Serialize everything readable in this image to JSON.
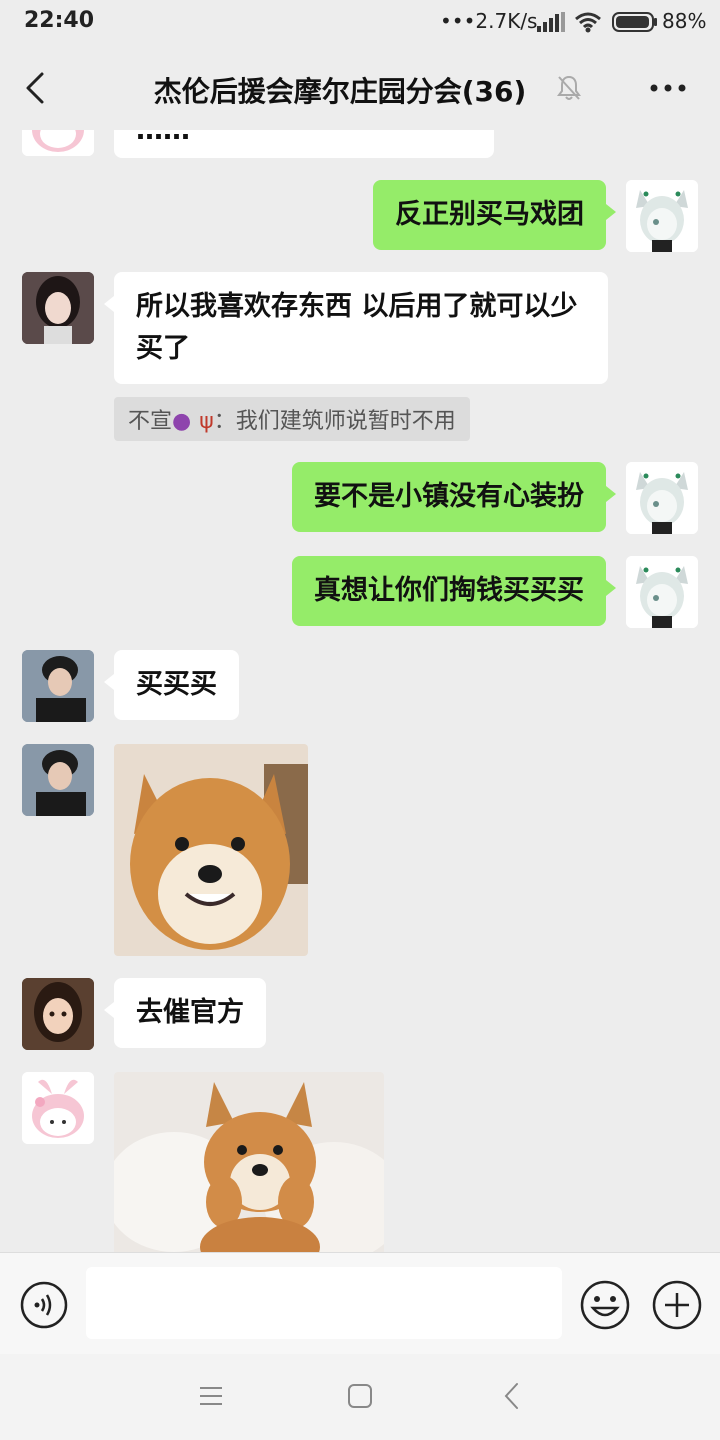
{
  "status_bar": {
    "time": "22:40",
    "network_speed": "•••2.7K/s",
    "battery": "88%"
  },
  "header": {
    "title": "杰伦后援会摩尔庄园分会(36)"
  },
  "messages": [
    {
      "side": "in",
      "text": "……",
      "avatar": "pink-melody-avatar"
    },
    {
      "side": "out",
      "text": "反正别买马戏团",
      "avatar": "anime-fox-girl-avatar"
    },
    {
      "side": "in",
      "text": "所以我喜欢存东西  以后用了就可以少买了",
      "avatar": "girl-photo-avatar"
    },
    {
      "side": "out",
      "text": "要不是小镇没有心装扮",
      "avatar": "anime-fox-girl-avatar"
    },
    {
      "side": "out",
      "text": "真想让你们掏钱买买买",
      "avatar": "anime-fox-girl-avatar"
    },
    {
      "side": "in",
      "text": "买买买",
      "avatar": "man-photo-avatar"
    },
    {
      "side": "in",
      "type": "image",
      "description": "shiba-sticker-1",
      "avatar": "man-photo-avatar"
    },
    {
      "side": "in",
      "text": "去催官方",
      "avatar": "cartoon-girl-avatar"
    },
    {
      "side": "in",
      "type": "image",
      "description": "shiba-sticker-2",
      "avatar": "pink-melody-avatar"
    }
  ],
  "system_notice": {
    "prefix": "不宣",
    "suffix": "：我们建筑师说暂时不用"
  },
  "input_bar": {
    "placeholder": ""
  },
  "colors": {
    "background": "#ededed",
    "outgoing_bubble": "#95ec69",
    "incoming_bubble": "#ffffff"
  }
}
